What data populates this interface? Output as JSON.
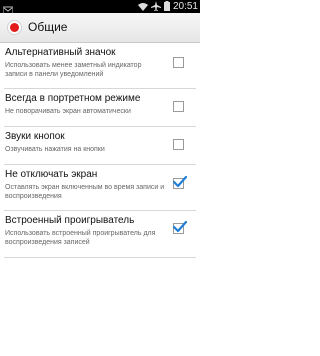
{
  "status_bar": {
    "time": "20:51",
    "icons": [
      "notification-icon",
      "wifi-icon",
      "airplane-icon",
      "battery-icon"
    ]
  },
  "action_bar": {
    "title": "Общие",
    "icon": "app-record-icon",
    "accent_color": "#e41b1b"
  },
  "settings": [
    {
      "title": "Альтернативный значок",
      "summary": "Использовать менее заметный индикатор записи в панели уведомлений",
      "checked": false
    },
    {
      "title": "Всегда в портретном режиме",
      "summary": "Не поворачивать экран автоматически",
      "checked": false
    },
    {
      "title": "Звуки кнопок",
      "summary": "Озвучивать нажатия на кнопки",
      "checked": false
    },
    {
      "title": "Не отключать экран",
      "summary": "Оставлять экран включенным во время записи и воспроизведения",
      "checked": true
    },
    {
      "title": "Встроенный проигрыватель",
      "summary": "Использовать встроенный проигрыватель для воспроизведения записей",
      "checked": true
    }
  ],
  "colors": {
    "check_color": "#1f7fd6"
  }
}
